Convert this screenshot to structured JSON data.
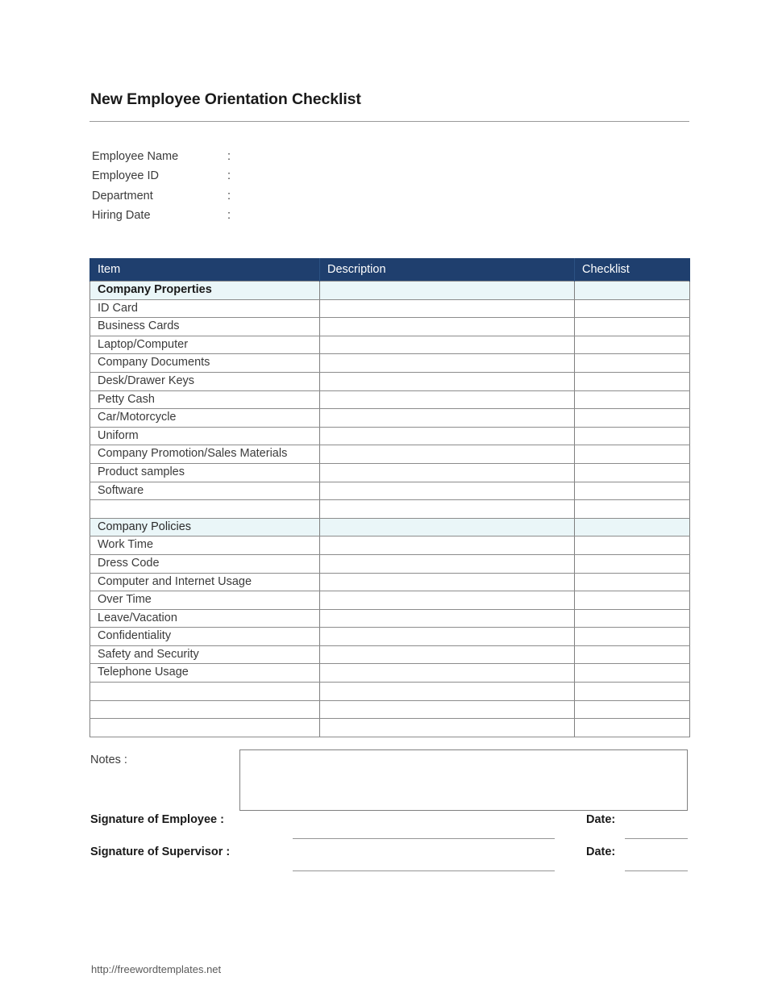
{
  "document": {
    "title": "New Employee Orientation Checklist",
    "footer_url": "http://freewordtemplates.net"
  },
  "info_fields": [
    {
      "label": "Employee Name",
      "colon": ":",
      "value": ""
    },
    {
      "label": "Employee ID",
      "colon": ":",
      "value": ""
    },
    {
      "label": "Department",
      "colon": ":",
      "value": ""
    },
    {
      "label": "Hiring Date",
      "colon": ":",
      "value": ""
    }
  ],
  "table": {
    "headers": [
      "Item",
      "Description",
      "Checklist"
    ],
    "header_bg": "#1f3f6e",
    "section_bg": "#eaf6f8",
    "rows": [
      {
        "item": "Company Properties",
        "description": "",
        "checklist": "",
        "type": "section",
        "bold": true
      },
      {
        "item": "ID Card",
        "description": "",
        "checklist": "",
        "type": "item"
      },
      {
        "item": "Business Cards",
        "description": "",
        "checklist": "",
        "type": "item"
      },
      {
        "item": "Laptop/Computer",
        "description": "",
        "checklist": "",
        "type": "item"
      },
      {
        "item": "Company Documents",
        "description": "",
        "checklist": "",
        "type": "item"
      },
      {
        "item": "Desk/Drawer Keys",
        "description": "",
        "checklist": "",
        "type": "item"
      },
      {
        "item": "Petty Cash",
        "description": "",
        "checklist": "",
        "type": "item"
      },
      {
        "item": "Car/Motorcycle",
        "description": "",
        "checklist": "",
        "type": "item"
      },
      {
        "item": "Uniform",
        "description": "",
        "checklist": "",
        "type": "item"
      },
      {
        "item": "Company Promotion/Sales Materials",
        "description": "",
        "checklist": "",
        "type": "item"
      },
      {
        "item": "Product samples",
        "description": "",
        "checklist": "",
        "type": "item"
      },
      {
        "item": "Software",
        "description": "",
        "checklist": "",
        "type": "item"
      },
      {
        "item": "",
        "description": "",
        "checklist": "",
        "type": "blank"
      },
      {
        "item": "Company Policies",
        "description": "",
        "checklist": "",
        "type": "section",
        "bold": false
      },
      {
        "item": "Work Time",
        "description": "",
        "checklist": "",
        "type": "item"
      },
      {
        "item": "Dress Code",
        "description": "",
        "checklist": "",
        "type": "item"
      },
      {
        "item": "Computer and Internet Usage",
        "description": "",
        "checklist": "",
        "type": "item"
      },
      {
        "item": "Over Time",
        "description": "",
        "checklist": "",
        "type": "item"
      },
      {
        "item": "Leave/Vacation",
        "description": "",
        "checklist": "",
        "type": "item"
      },
      {
        "item": "Confidentiality",
        "description": "",
        "checklist": "",
        "type": "item"
      },
      {
        "item": "Safety and Security",
        "description": "",
        "checklist": "",
        "type": "item"
      },
      {
        "item": "Telephone Usage",
        "description": "",
        "checklist": "",
        "type": "item"
      },
      {
        "item": "",
        "description": "",
        "checklist": "",
        "type": "blank"
      },
      {
        "item": "",
        "description": "",
        "checklist": "",
        "type": "blank"
      },
      {
        "item": "",
        "description": "",
        "checklist": "",
        "type": "blank"
      }
    ]
  },
  "notes": {
    "label": "Notes :",
    "value": ""
  },
  "signatures": {
    "employee_label": "Signature of Employee :",
    "supervisor_label": "Signature of Supervisor :",
    "date_label_1": "Date:",
    "date_label_2": "Date:",
    "employee_value": "",
    "supervisor_value": "",
    "date_value_1": "",
    "date_value_2": ""
  }
}
